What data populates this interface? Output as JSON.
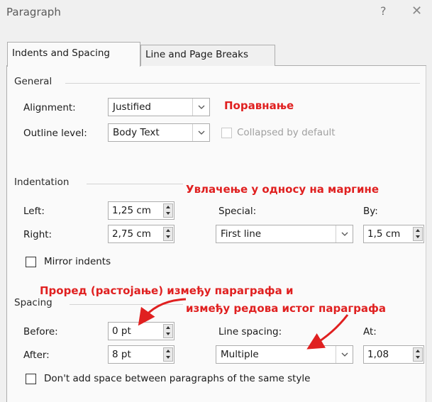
{
  "window": {
    "title": "Paragraph",
    "help": "?",
    "close": "✕"
  },
  "tabs": [
    {
      "label": "Indents and Spacing"
    },
    {
      "label": "Line and Page Breaks"
    }
  ],
  "general": {
    "heading": "General",
    "alignment_label": "Alignment:",
    "alignment_value": "Justified",
    "outline_label": "Outline level:",
    "outline_value": "Body Text",
    "collapsed_label": "Collapsed by default"
  },
  "indentation": {
    "heading": "Indentation",
    "left_label": "Left:",
    "left_value": "1,25 cm",
    "right_label": "Right:",
    "right_value": "2,75 cm",
    "special_label": "Special:",
    "special_value": "First line",
    "by_label": "By:",
    "by_value": "1,5 cm",
    "mirror_label": "Mirror indents"
  },
  "spacing": {
    "heading": "Spacing",
    "before_label": "Before:",
    "before_value": "0 pt",
    "after_label": "After:",
    "after_value": "8 pt",
    "line_spacing_label": "Line spacing:",
    "line_spacing_value": "Multiple",
    "at_label": "At:",
    "at_value": "1,08",
    "dont_add_label": "Don't add space between paragraphs of the same style"
  },
  "annotations": {
    "alignment": "Поравнање",
    "indentation": "Увлачење у односу на маргине",
    "spacing_line1": "Проред (растојање) између параграфа и",
    "spacing_line2": "између редова истог параграфа",
    "color": "#e02020"
  }
}
